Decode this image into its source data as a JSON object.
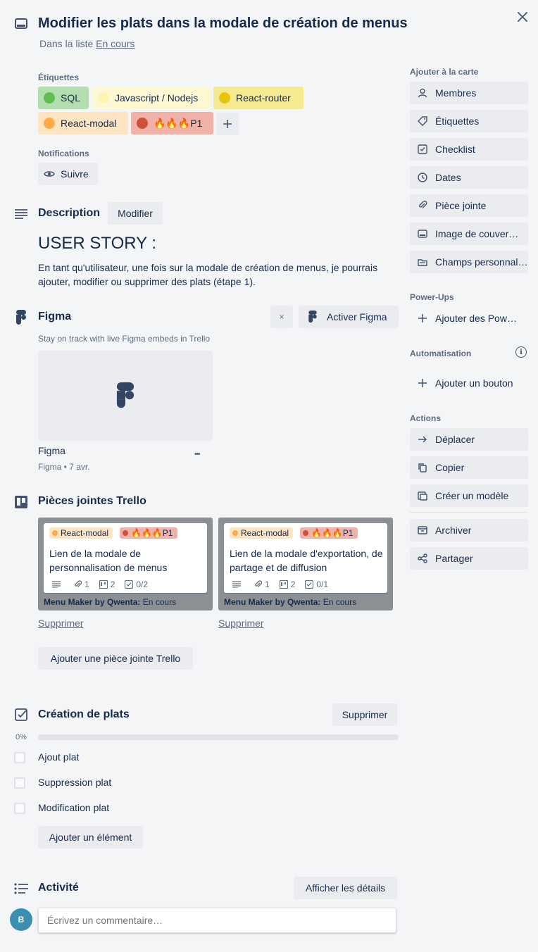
{
  "card": {
    "title": "Modifier les plats dans la modale de création de menus",
    "list_prefix": "Dans la liste",
    "list_name": "En cours"
  },
  "labels_section": {
    "heading": "Étiquettes",
    "items": [
      {
        "text": "SQL",
        "bg": "#b3dfb0",
        "dot": "#61bd4f"
      },
      {
        "text": "Javascript / Nodejs",
        "bg": "#fdf8d3",
        "dot": "#fdf3b3"
      },
      {
        "text": "React-router",
        "bg": "#f5ea92",
        "dot": "#e6c60d"
      },
      {
        "text": "React-modal",
        "bg": "#fde4c3",
        "dot": "#ffab4a"
      },
      {
        "text": "🔥🔥🔥P1",
        "bg": "#f0b1a8",
        "dot": "#cf513d"
      }
    ],
    "add_label": "+"
  },
  "notifications": {
    "heading": "Notifications",
    "follow_label": "Suivre"
  },
  "description": {
    "heading": "Description",
    "edit_label": "Modifier",
    "story_title": "USER STORY :",
    "story_text": "En tant qu'utilisateur, une fois sur la modale de création de menus, je pourrais ajouter, modifier ou supprimer des plats (étape 1)."
  },
  "figma": {
    "heading": "Figma",
    "close_label": "×",
    "activate_label": "Activer Figma",
    "tagline": "Stay on track with live Figma embeds in Trello",
    "tile_title": "Figma",
    "tile_meta": "Figma • 7 avr.",
    "more_label": "•••"
  },
  "trello_attachments": {
    "heading": "Pièces jointes Trello",
    "cards": [
      {
        "label1": "React-modal",
        "label2": "🔥🔥🔥P1",
        "title": "Lien de la modale de personnalisation de menus",
        "attachments": "1",
        "cards": "2",
        "checklist": "0/2",
        "board": "Menu Maker by Qwenta:",
        "list": "En cours",
        "remove": "Supprimer"
      },
      {
        "label1": "React-modal",
        "label2": "🔥🔥🔥P1",
        "title": "Lien de la modale d'exportation, de partage et de diffusion",
        "attachments": "1",
        "cards": "2",
        "checklist": "0/1",
        "board": "Menu Maker by Qwenta:",
        "list": "En cours",
        "remove": "Supprimer"
      }
    ],
    "add_label": "Ajouter une pièce jointe Trello"
  },
  "checklist": {
    "heading": "Création de plats",
    "delete_label": "Supprimer",
    "progress_text": "0%",
    "progress": 0,
    "items": [
      "Ajout plat",
      "Suppression plat",
      "Modification plat"
    ],
    "add_label": "Ajouter un élément"
  },
  "activity": {
    "heading": "Activité",
    "details_label": "Afficher les détails",
    "avatar_initial": "B",
    "comment_placeholder": "Écrivez un commentaire…"
  },
  "sidebar": {
    "add_heading": "Ajouter à la carte",
    "add_items": [
      "Membres",
      "Étiquettes",
      "Checklist",
      "Dates",
      "Pièce jointe",
      "Image de couver…",
      "Champs personnal…"
    ],
    "powerups_heading": "Power-Ups",
    "powerups_add": "Ajouter des Pow…",
    "automation_heading": "Automatisation",
    "automation_add": "Ajouter un bouton",
    "actions_heading": "Actions",
    "actions": [
      "Déplacer",
      "Copier",
      "Créer un modèle"
    ],
    "archive": "Archiver",
    "share": "Partager"
  }
}
